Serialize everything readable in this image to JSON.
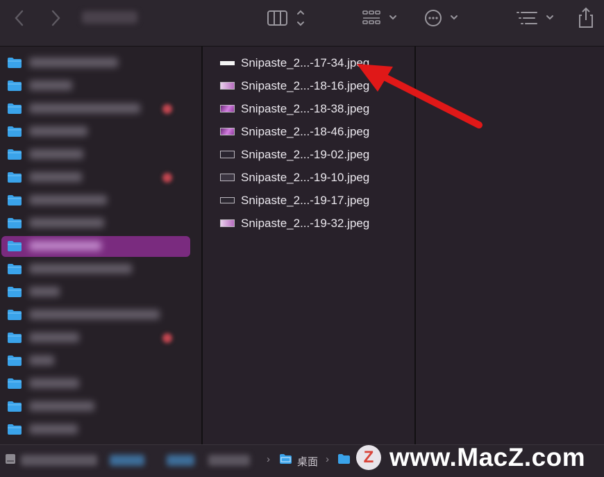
{
  "toolbar": {
    "back_icon": "chevron-left-icon",
    "forward_icon": "chevron-right-icon",
    "view_columns_icon": "columns-view-icon",
    "group_icon": "group-grid-icon",
    "action_icon": "more-ellipsis-icon",
    "sort_icon": "sort-list-icon",
    "share_icon": "share-icon"
  },
  "sidebar": {
    "selected_index": 8,
    "folder_color": "#3aa3ea",
    "items": [
      {
        "label": "",
        "badge": false
      },
      {
        "label": "",
        "badge": false
      },
      {
        "label": "",
        "badge": true
      },
      {
        "label": "",
        "badge": false
      },
      {
        "label": "",
        "badge": false
      },
      {
        "label": "",
        "badge": true
      },
      {
        "label": "",
        "badge": false
      },
      {
        "label": "",
        "badge": false
      },
      {
        "label": "",
        "badge": false
      },
      {
        "label": "",
        "badge": false
      },
      {
        "label": "",
        "badge": false
      },
      {
        "label": "",
        "badge": false
      },
      {
        "label": "",
        "badge": true
      },
      {
        "label": "",
        "badge": false
      },
      {
        "label": "",
        "badge": false
      },
      {
        "label": "",
        "badge": false
      },
      {
        "label": "",
        "badge": false
      }
    ]
  },
  "files": [
    {
      "name": "Snipaste_2...-17-34.jpeg",
      "thumb": "t-white"
    },
    {
      "name": "Snipaste_2...-18-16.jpeg",
      "thumb": "t-pink"
    },
    {
      "name": "Snipaste_2...-18-38.jpeg",
      "thumb": "t-purple"
    },
    {
      "name": "Snipaste_2...-18-46.jpeg",
      "thumb": "t-purple"
    },
    {
      "name": "Snipaste_2...-19-02.jpeg",
      "thumb": "t-dark"
    },
    {
      "name": "Snipaste_2...-19-10.jpeg",
      "thumb": "t-dark2"
    },
    {
      "name": "Snipaste_2...-19-17.jpeg",
      "thumb": "t-outline"
    },
    {
      "name": "Snipaste_2...-19-32.jpeg",
      "thumb": "t-pink"
    }
  ],
  "pathbar": {
    "desktop_label": "桌面",
    "separator": "›"
  },
  "watermark": {
    "logo_letter": "Z",
    "text": "www.MacZ.com"
  },
  "annotation": {
    "arrow_color": "#e01818"
  }
}
